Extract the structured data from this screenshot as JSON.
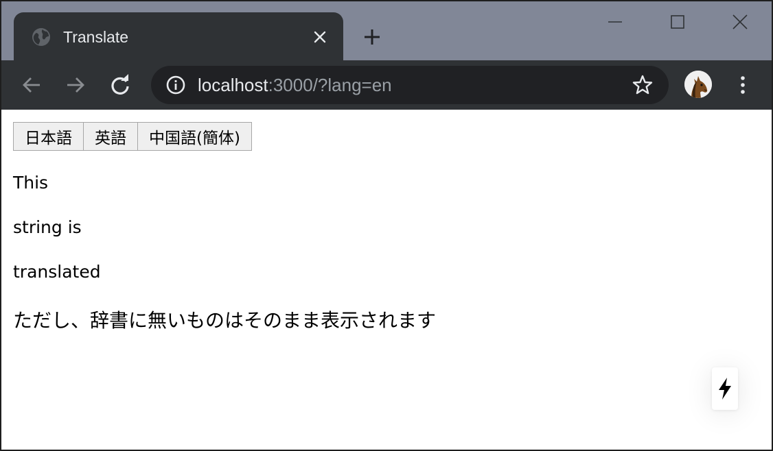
{
  "browser": {
    "tab": {
      "title": "Translate",
      "favicon": "globe-icon"
    },
    "url": {
      "host": "localhost",
      "rest": ":3000/?lang=en"
    },
    "icons": {
      "close_tab": "close-icon",
      "new_tab": "plus-icon",
      "minimize": "minimize-icon",
      "maximize": "maximize-icon",
      "close_window": "close-icon",
      "back": "arrow-left-icon",
      "forward": "arrow-right-icon",
      "reload": "reload-icon",
      "site_info": "info-icon",
      "bookmark": "star-icon",
      "profile": "horse-avatar",
      "menu": "more-vert-icon"
    },
    "colors": {
      "tab_strip": "#818797",
      "toolbar": "#2f3235",
      "omnibox": "#202124",
      "url_host": "#e8eaed",
      "url_rest": "#9aa0a6"
    }
  },
  "page": {
    "language_buttons": [
      {
        "label": "日本語"
      },
      {
        "label": "英語"
      },
      {
        "label": "中国語(簡体)"
      }
    ],
    "lines": [
      "This",
      "string is",
      "translated",
      "ただし、辞書に無いものはそのまま表示されます"
    ],
    "badge_icon": "lightning-bolt-icon"
  }
}
